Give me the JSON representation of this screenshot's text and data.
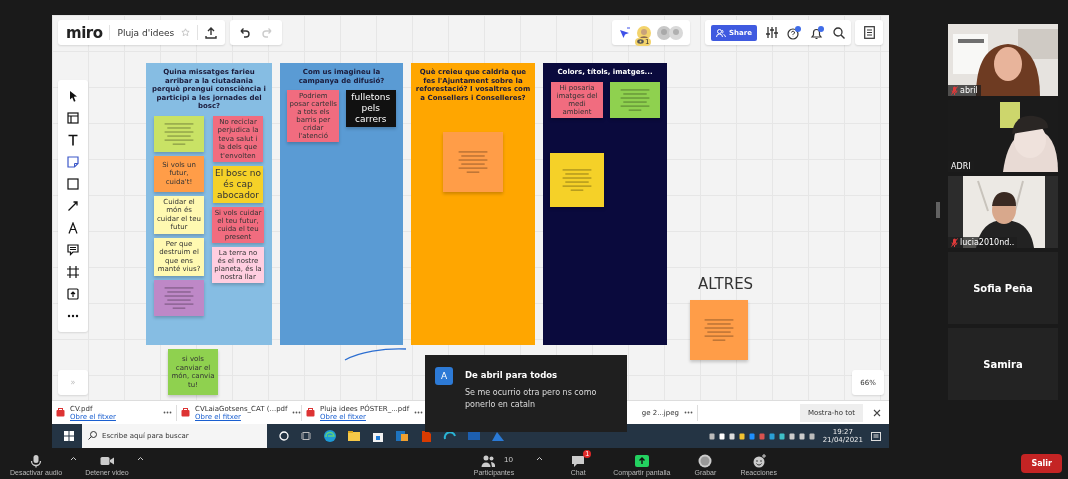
{
  "miro": {
    "logo": "miro",
    "board_title": "Pluja d'idees",
    "starred": false,
    "viewers": "1",
    "share": "Share",
    "zoom_level": "66%",
    "expand": "»"
  },
  "frames": [
    {
      "title": "Quina missatges farieu arribar a la ciutadania perquè prengui consciència i participi a les jornades del bosc?",
      "color": "#86bde3",
      "stacks": [
        {
          "notes": [
            {
              "kind": "scribble",
              "color": "#c9e265"
            },
            {
              "kind": "medium",
              "text": "Si vols un futur, cuida't!",
              "color": "#ff9d48"
            },
            {
              "kind": "medium",
              "text": "Cuidar el món és cuidar el teu futur",
              "color": "#fff9b1"
            },
            {
              "kind": "medium",
              "text": "Per que destruim el que ens manté vius?",
              "color": "#fff9b1"
            },
            {
              "kind": "scribble",
              "color": "#be88c7"
            }
          ]
        },
        {
          "notes": [
            {
              "kind": "medium",
              "text": "No reciclar perjudica la teva salut i la dels que t'envolten",
              "color": "#f16c7f"
            },
            {
              "kind": "large",
              "text": "El bosc no és cap abocador",
              "color": "#f5d128"
            },
            {
              "kind": "small",
              "text": "Si vols cuidar el teu futur, cuida el teu present",
              "color": "#f16c7f"
            },
            {
              "kind": "small",
              "text": "La terra no és el nostre planeta, és la nostra llar",
              "color": "#ffcee0"
            }
          ]
        }
      ]
    },
    {
      "title": "Com us imagineu la campanya de difusió?",
      "color": "#5a9bd4",
      "stacks": [
        {
          "notes": [
            {
              "kind": "small",
              "text": "Podriem posar cartells a tots els barris per cridar l'atenció",
              "color": "#f16c7f"
            }
          ]
        },
        {
          "notes": [
            {
              "kind": "large",
              "text": "fulletons pels carrers",
              "color": "#111111"
            }
          ]
        }
      ]
    },
    {
      "title": "Què creieu que caldria que fes l'Ajuntament sobre la reforestació? I vosaltres com a Consellers i Conselleres?",
      "color": "#ffa600",
      "stacks": [
        {
          "notes": [
            {
              "kind": "scribble",
              "color": "#ff9d48"
            }
          ]
        }
      ]
    },
    {
      "title": "Colors, títols, imatges...",
      "color": "#0a0a3d",
      "stacks": [
        {
          "notes": [
            {
              "kind": "small",
              "text": "Hi posaria imatges del medi ambient",
              "color": "#f16c7f"
            },
            {
              "kind": "scribble",
              "color": "#f5d128"
            }
          ]
        },
        {
          "notes": [
            {
              "kind": "scribble",
              "color": "#8fd14f"
            }
          ]
        }
      ]
    }
  ],
  "loose": {
    "heading": "ALTRES",
    "notes": [
      {
        "kind": "scribble",
        "color": "#ff9d48"
      },
      {
        "kind": "medium",
        "text": "si vols canviar el món, canvia tu!",
        "color": "#8fd14f"
      }
    ]
  },
  "downloads": {
    "items": [
      {
        "file": "CV.pdf",
        "action": "Obre el fitxer"
      },
      {
        "file": "CVLaiaGotsens_CAT (...pdf",
        "action": "Obre el fitxer"
      },
      {
        "file": "Pluja idees PÓSTER_...pdf",
        "action": "Obre el fitxer"
      },
      {
        "file": "ge 2...jpeg"
      }
    ],
    "show_all": "Mostra-ho tot"
  },
  "taskbar": {
    "search_placeholder": "Escribe aquí para buscar",
    "time": "19:27",
    "date": "21/04/2021"
  },
  "notification": {
    "avatar": "A",
    "title": "De abril para todos",
    "message": "Se me ocurrio otra pero ns como ponerlo en cataln"
  },
  "participants": [
    {
      "name": "abril",
      "kind": "video",
      "muted": true
    },
    {
      "name": "ADRI",
      "kind": "video",
      "muted": false
    },
    {
      "name": "lucia2010nd..",
      "kind": "video",
      "muted": true
    },
    {
      "name": "Sofia Peña",
      "kind": "name"
    },
    {
      "name": "Samira",
      "kind": "name"
    }
  ],
  "controls": [
    {
      "kind": "mic",
      "label": "Desactivar audio",
      "caret": true
    },
    {
      "kind": "camera",
      "label": "Detener video",
      "caret": true
    },
    {
      "kind": "people",
      "label": "Participantes",
      "count": "10",
      "caret": true
    },
    {
      "kind": "chat",
      "label": "Chat",
      "badge": "1",
      "caret": false
    },
    {
      "kind": "share",
      "label": "Compartir pantalla",
      "caret": false
    },
    {
      "kind": "record",
      "label": "Grabar",
      "caret": false
    },
    {
      "kind": "reaction",
      "label": "Reacciones",
      "caret": false
    }
  ],
  "leave": "Salir"
}
